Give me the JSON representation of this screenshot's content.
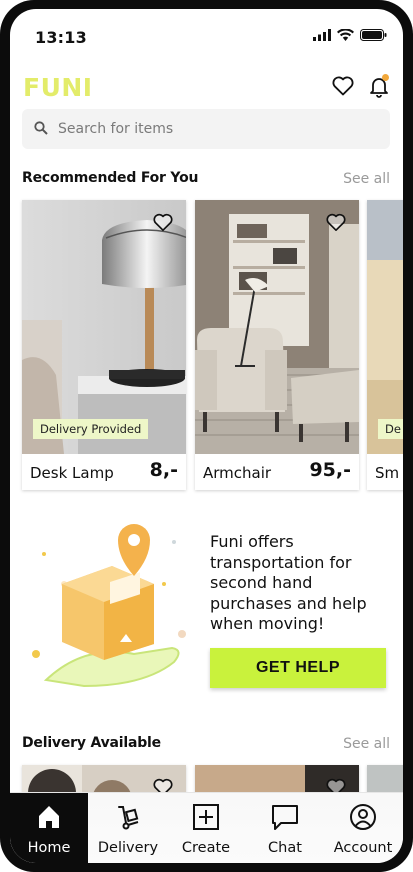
{
  "status_bar": {
    "time": "13:13"
  },
  "header": {
    "logo": "FUNI"
  },
  "search": {
    "placeholder": "Search for items"
  },
  "recommended": {
    "title": "Recommended For You",
    "see_all": "See all",
    "items": [
      {
        "name": "Desk Lamp",
        "price": "8,-",
        "badge": "Delivery Provided"
      },
      {
        "name": "Armchair",
        "price": "95,-",
        "badge": ""
      },
      {
        "name": "Sm",
        "price": "",
        "badge": "De"
      }
    ]
  },
  "promo": {
    "text": "Funi offers transportation for second hand purchases and help when moving!",
    "button": "GET HELP"
  },
  "delivery": {
    "title": "Delivery Available",
    "see_all": "See all"
  },
  "tabs": [
    {
      "label": "Home",
      "icon": "home-icon",
      "active": true
    },
    {
      "label": "Delivery",
      "icon": "hand-truck-icon",
      "active": false
    },
    {
      "label": "Create",
      "icon": "plus-square-icon",
      "active": false
    },
    {
      "label": "Chat",
      "icon": "chat-bubble-icon",
      "active": false
    },
    {
      "label": "Account",
      "icon": "user-circle-icon",
      "active": false
    }
  ],
  "colors": {
    "brand": "#e3ec6a",
    "accent_button": "#c9f23c",
    "badge_bg": "#eef7c8",
    "notification_dot": "#f2a83b"
  }
}
